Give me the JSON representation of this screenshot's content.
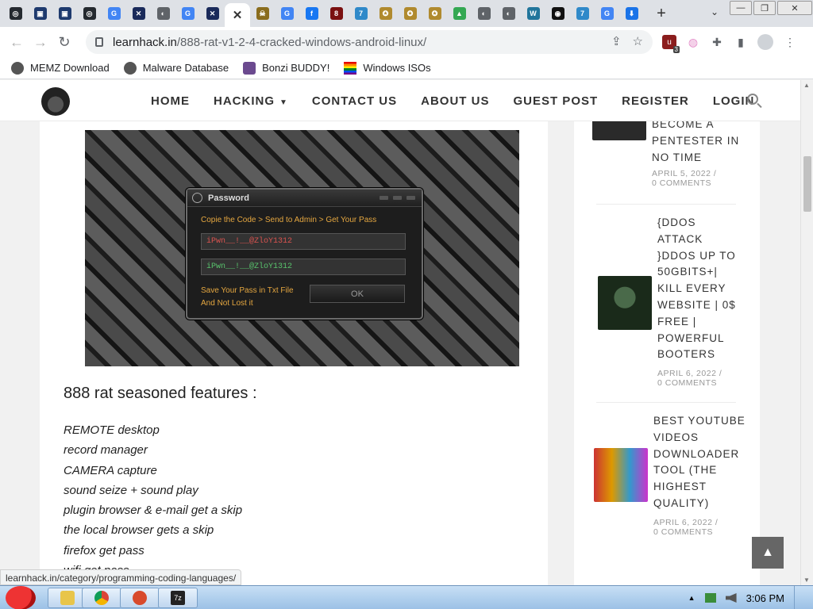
{
  "browser": {
    "tabs": [
      {
        "icon": "github-icon",
        "color": "#24292f",
        "glyph": "◎"
      },
      {
        "icon": "app-icon",
        "color": "#1e3a6e",
        "glyph": "▣"
      },
      {
        "icon": "app-icon",
        "color": "#1e3a6e",
        "glyph": "▣"
      },
      {
        "icon": "github-icon",
        "color": "#24292f",
        "glyph": "◎"
      },
      {
        "icon": "google-icon",
        "color": "#4285f4",
        "glyph": "G"
      },
      {
        "icon": "site-icon",
        "color": "#1a2a5a",
        "glyph": "✕"
      },
      {
        "icon": "globe-icon",
        "color": "#5f6368",
        "glyph": "◐"
      },
      {
        "icon": "google-icon",
        "color": "#4285f4",
        "glyph": "G"
      },
      {
        "icon": "site-icon",
        "color": "#1a2a5a",
        "glyph": "✕"
      },
      {
        "icon": "close-icon",
        "active": true,
        "glyph": "✕"
      },
      {
        "icon": "skull-icon",
        "color": "#8a6d1e",
        "glyph": "☠"
      },
      {
        "icon": "google-icon",
        "color": "#4285f4",
        "glyph": "G"
      },
      {
        "icon": "facebook-icon",
        "color": "#1877f2",
        "glyph": "f"
      },
      {
        "icon": "app-icon",
        "color": "#7a1010",
        "glyph": "8"
      },
      {
        "icon": "sevenzip-icon",
        "color": "#2f89c9",
        "glyph": "7"
      },
      {
        "icon": "emblem-icon",
        "color": "#b08a2e",
        "glyph": "✪"
      },
      {
        "icon": "emblem-icon",
        "color": "#b08a2e",
        "glyph": "✪"
      },
      {
        "icon": "emblem-icon",
        "color": "#b08a2e",
        "glyph": "✪"
      },
      {
        "icon": "drive-icon",
        "color": "#34a853",
        "glyph": "▲"
      },
      {
        "icon": "globe-icon",
        "color": "#5f6368",
        "glyph": "◐"
      },
      {
        "icon": "globe-icon",
        "color": "#5f6368",
        "glyph": "◐"
      },
      {
        "icon": "wordpress-icon",
        "color": "#21759b",
        "glyph": "W"
      },
      {
        "icon": "app-icon",
        "color": "#111",
        "glyph": "◉"
      },
      {
        "icon": "sevenzip-icon",
        "color": "#2f89c9",
        "glyph": "7"
      },
      {
        "icon": "google-icon",
        "color": "#4285f4",
        "glyph": "G"
      },
      {
        "icon": "download-icon",
        "color": "#1a73e8",
        "glyph": "⬇"
      }
    ],
    "url_host": "learnhack.in",
    "url_path": "/888-rat-v1-2-4-cracked-windows-android-linux/",
    "ublock_count": "3",
    "bookmarks": [
      {
        "label": "MEMZ Download"
      },
      {
        "label": "Malware Database"
      },
      {
        "label": "Bonzi BUDDY!"
      },
      {
        "label": "Windows ISOs"
      }
    ],
    "status_link": "learnhack.in/category/programming-coding-languages/"
  },
  "site": {
    "nav": [
      "HOME",
      "HACKING",
      "CONTACT US",
      "ABOUT US",
      "GUEST POST",
      "REGISTER",
      "LOGIN"
    ],
    "dialog": {
      "title": "Password",
      "instruction": "Copie the Code > Send to Admin > Get Your Pass",
      "field1": "iPwn__!__@ZloY1312",
      "field2": "iPwn__!__@ZloY1312",
      "note_line1": "Save Your Pass in Txt File",
      "note_line2": "And Not Lost it",
      "ok_label": "OK"
    },
    "heading": "888 rat seasoned features :",
    "features": [
      "REMOTE desktop",
      "record manager",
      "CAMERA capture",
      "sound seize + sound play",
      "plugin browser & e-mail get a skip",
      "the local browser gets a skip",
      "firefox get pass",
      "wifi get pass"
    ],
    "sidebar_posts": [
      {
        "title_lines": [
          "BECOME A",
          "PENTESTER IN",
          "NO TIME"
        ],
        "date": "APRIL 5, 2022",
        "comments": "0 COMMENTS"
      },
      {
        "title_lines": [
          "{DDOS",
          "ATTACK",
          "}DDOS UP TO",
          "50GBITS+|",
          "KILL EVERY",
          "WEBSITE | 0$",
          "FREE |",
          "POWERFUL",
          "BOOTERS"
        ],
        "date": "APRIL 6, 2022",
        "comments": "0 COMMENTS"
      },
      {
        "title_lines": [
          "BEST YOUTUBE",
          "VIDEOS",
          "DOWNLOADER",
          "TOOL (THE",
          "HIGHEST",
          "QUALITY)"
        ],
        "date": "APRIL 6, 2022",
        "comments": "0 COMMENTS"
      }
    ]
  },
  "taskbar": {
    "clock": "3:06 PM"
  }
}
